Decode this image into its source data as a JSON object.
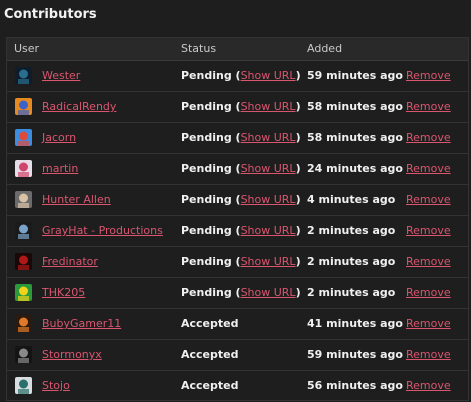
{
  "section_title": "Contributors",
  "columns": {
    "user": "User",
    "status": "Status",
    "added": "Added"
  },
  "pending_prefix": "Pending (",
  "pending_suffix": ")",
  "show_url_label": "Show URL",
  "remove_label": "Remove",
  "rows": [
    {
      "name": "Wester",
      "status": "Pending",
      "added": "59 minutes ago",
      "avatar_colors": [
        "#0f1c2a",
        "#2a6f8f"
      ]
    },
    {
      "name": "RadicalRendy",
      "status": "Pending",
      "added": "58 minutes ago",
      "avatar_colors": [
        "#e68a1f",
        "#3b62c9"
      ]
    },
    {
      "name": "Jacorn",
      "status": "Pending",
      "added": "58 minutes ago",
      "avatar_colors": [
        "#3a8de0",
        "#e04a3a"
      ]
    },
    {
      "name": "martin",
      "status": "Pending",
      "added": "24 minutes ago",
      "avatar_colors": [
        "#e7dde6",
        "#d0456c"
      ]
    },
    {
      "name": "Hunter Allen",
      "status": "Pending",
      "added": "4 minutes ago",
      "avatar_colors": [
        "#6b6b6b",
        "#d9c2a6"
      ]
    },
    {
      "name": "GrayHat - Productions",
      "status": "Pending",
      "added": "2 minutes ago",
      "avatar_colors": [
        "#1a1a1a",
        "#7aa2c9"
      ]
    },
    {
      "name": "Fredinator",
      "status": "Pending",
      "added": "2 minutes ago",
      "avatar_colors": [
        "#1a0808",
        "#b01818"
      ]
    },
    {
      "name": "THK205",
      "status": "Pending",
      "added": "2 minutes ago",
      "avatar_colors": [
        "#2a9a3a",
        "#f2d21a"
      ]
    },
    {
      "name": "BubyGamer11",
      "status": "Accepted",
      "added": "41 minutes ago",
      "avatar_colors": [
        "#2a1a10",
        "#e07a2a"
      ]
    },
    {
      "name": "Stormonyx",
      "status": "Accepted",
      "added": "59 minutes ago",
      "avatar_colors": [
        "#141414",
        "#8a8a8a"
      ]
    },
    {
      "name": "Stojo",
      "status": "Accepted",
      "added": "56 minutes ago",
      "avatar_colors": [
        "#d8dde0",
        "#2a6f6a"
      ]
    }
  ],
  "colors": {
    "background": "#1e1e1e",
    "link": "#d9566f",
    "text": "#f0f0f0",
    "header_bg": "#292929"
  }
}
